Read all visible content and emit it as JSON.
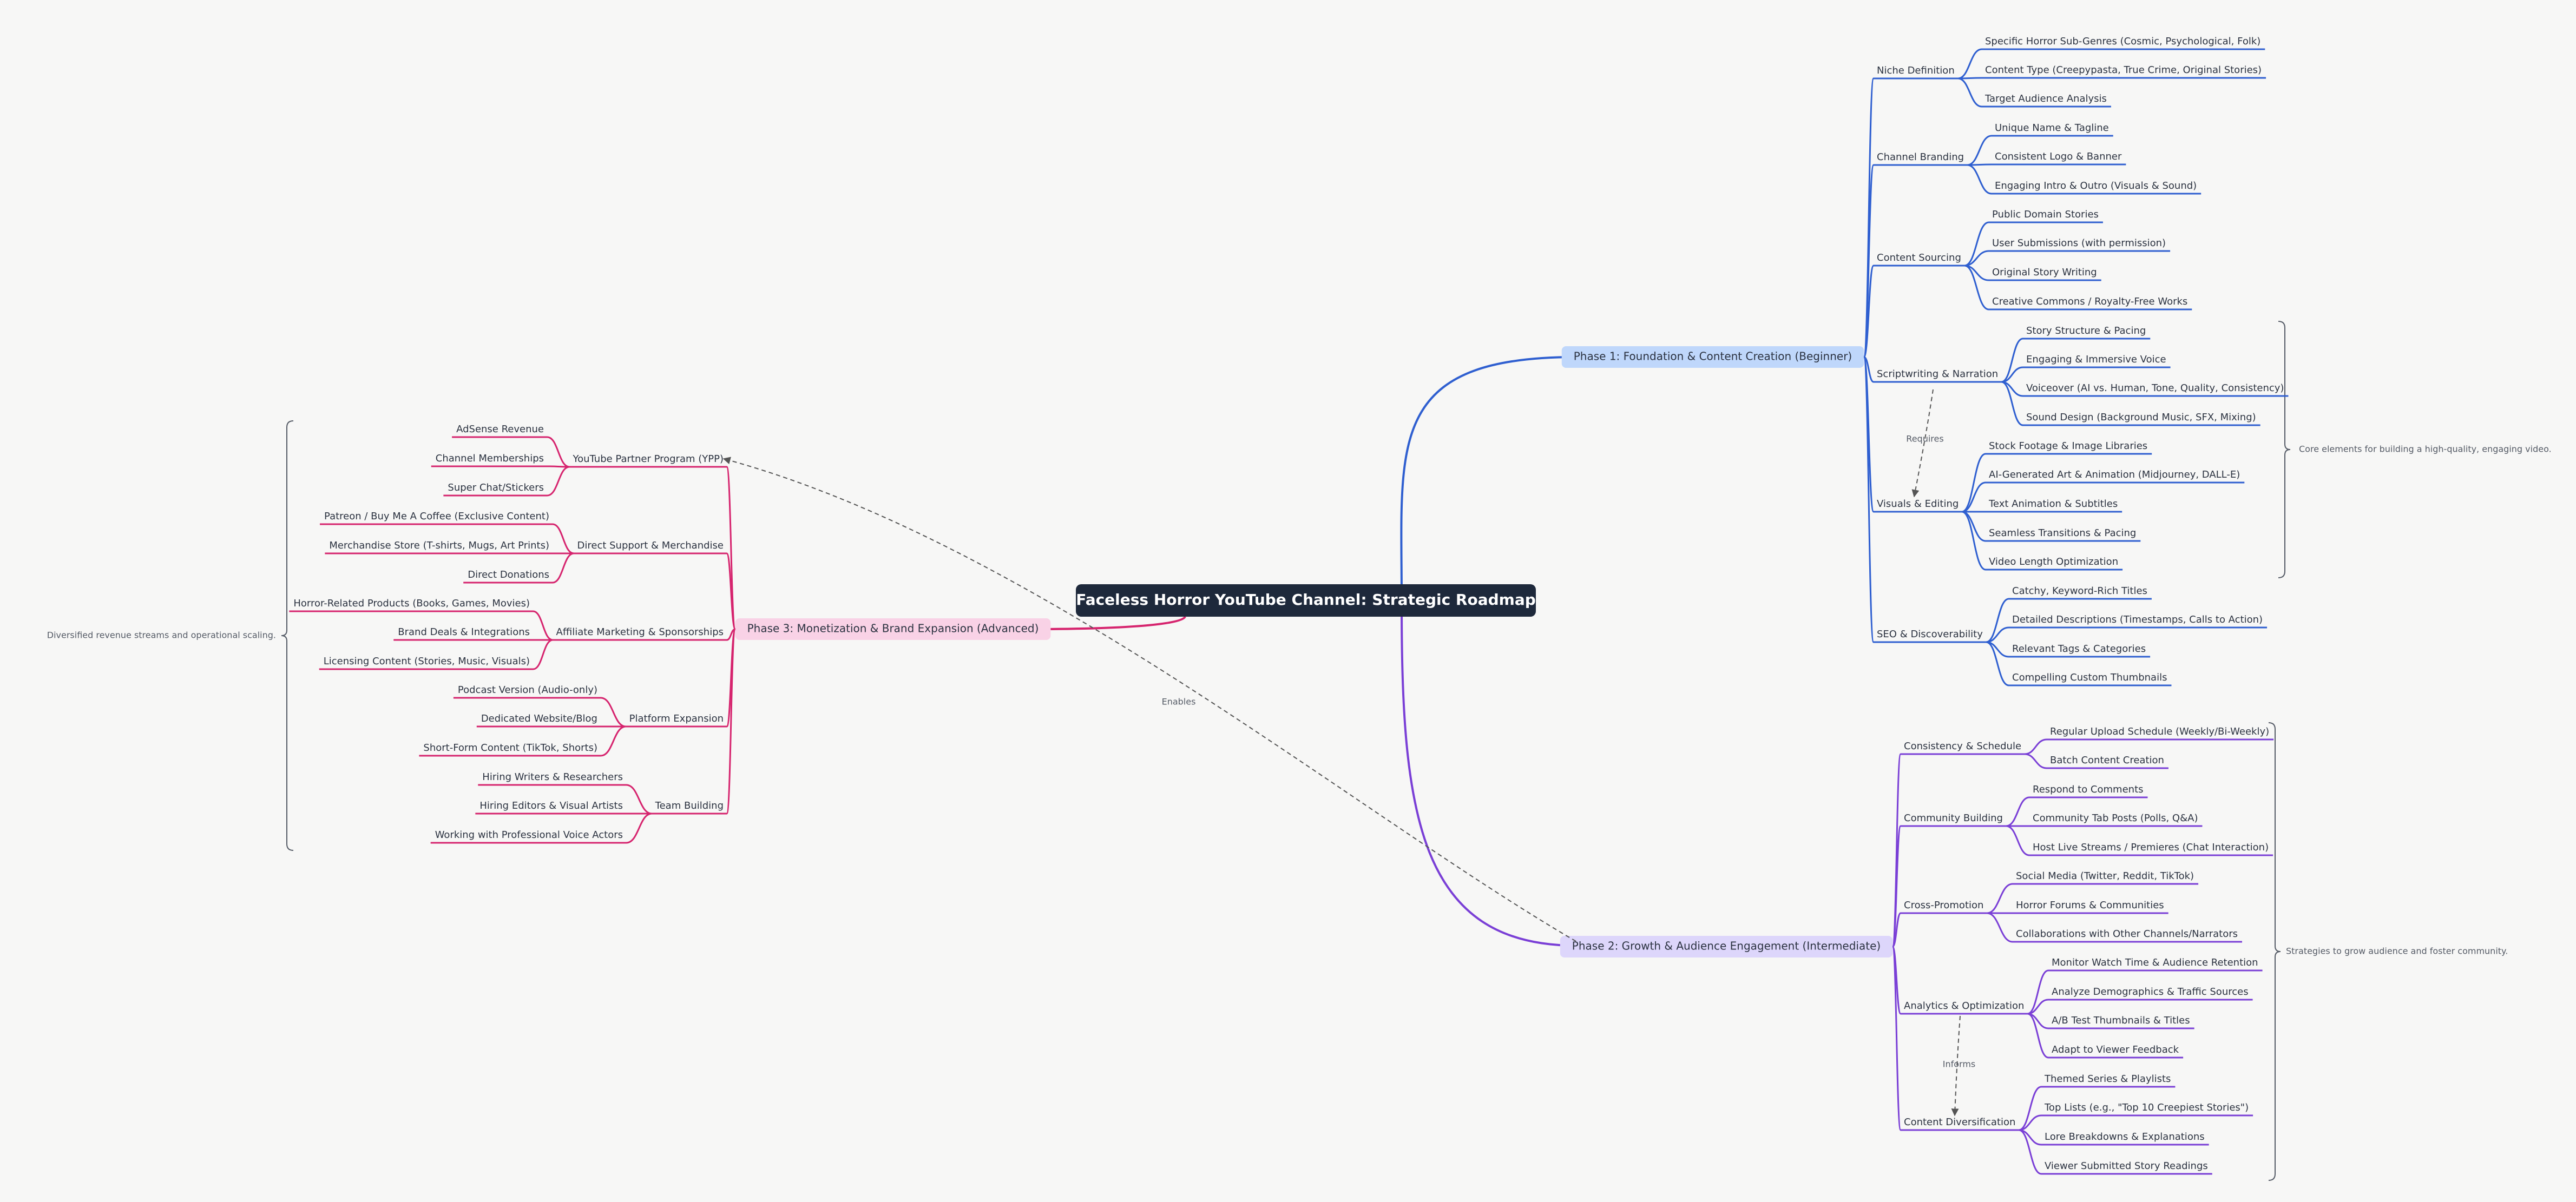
{
  "title": "Faceless Horror YouTube Channel: Strategic Roadmap",
  "colors": {
    "background": "#f7f7f6",
    "root_fill": "#1e293b",
    "phase1_line": "#2f5fd0",
    "phase1_fill": "#bfd7fb",
    "phase2_line": "#7a3fd6",
    "phase2_fill": "#ddd6fb",
    "phase3_line": "#d6246e",
    "phase3_fill": "#f9d2e6",
    "text": "#2b3240",
    "annotation": "#555b66"
  },
  "phase1": {
    "label": "Phase 1: Foundation & Content Creation (Beginner)",
    "summary": "Core elements for building a high-quality, engaging video.",
    "groups": [
      {
        "label": "Niche Definition",
        "items": [
          "Specific Horror Sub-Genres (Cosmic, Psychological, Folk)",
          "Content Type (Creepypasta, True Crime, Original Stories)",
          "Target Audience Analysis"
        ]
      },
      {
        "label": "Channel Branding",
        "items": [
          "Unique Name & Tagline",
          "Consistent Logo & Banner",
          "Engaging Intro & Outro (Visuals & Sound)"
        ]
      },
      {
        "label": "Content Sourcing",
        "items": [
          "Public Domain Stories",
          "User Submissions (with permission)",
          "Original Story Writing",
          "Creative Commons / Royalty-Free Works"
        ]
      },
      {
        "label": "Scriptwriting & Narration",
        "items": [
          "Story Structure & Pacing",
          "Engaging & Immersive Voice",
          "Voiceover (AI vs. Human, Tone, Quality, Consistency)",
          "Sound Design (Background Music, SFX, Mixing)"
        ]
      },
      {
        "label": "Visuals & Editing",
        "items": [
          "Stock Footage & Image Libraries",
          "AI-Generated Art & Animation (Midjourney, DALL-E)",
          "Text Animation & Subtitles",
          "Seamless Transitions & Pacing",
          "Video Length Optimization"
        ]
      },
      {
        "label": "SEO & Discoverability",
        "items": [
          "Catchy, Keyword-Rich Titles",
          "Detailed Descriptions (Timestamps, Calls to Action)",
          "Relevant Tags & Categories",
          "Compelling Custom Thumbnails"
        ]
      }
    ]
  },
  "phase2": {
    "label": "Phase 2: Growth & Audience Engagement (Intermediate)",
    "summary": "Strategies to grow audience and foster community.",
    "groups": [
      {
        "label": "Consistency & Schedule",
        "items": [
          "Regular Upload Schedule (Weekly/Bi-Weekly)",
          "Batch Content Creation"
        ]
      },
      {
        "label": "Community Building",
        "items": [
          "Respond to Comments",
          "Community Tab Posts (Polls, Q&A)",
          "Host Live Streams / Premieres (Chat Interaction)"
        ]
      },
      {
        "label": "Cross-Promotion",
        "items": [
          "Social Media (Twitter, Reddit, TikTok)",
          "Horror Forums & Communities",
          "Collaborations with Other Channels/Narrators"
        ]
      },
      {
        "label": "Analytics & Optimization",
        "items": [
          "Monitor Watch Time & Audience Retention",
          "Analyze Demographics & Traffic Sources",
          "A/B Test Thumbnails & Titles",
          "Adapt to Viewer Feedback"
        ]
      },
      {
        "label": "Content Diversification",
        "items": [
          "Themed Series & Playlists",
          "Top Lists (e.g., \"Top 10 Creepiest Stories\")",
          "Lore Breakdowns & Explanations",
          "Viewer Submitted Story Readings"
        ]
      }
    ]
  },
  "phase3": {
    "label": "Phase 3: Monetization & Brand Expansion (Advanced)",
    "summary": "Diversified revenue streams and operational scaling.",
    "groups": [
      {
        "label": "YouTube Partner Program (YPP)",
        "items": [
          "AdSense Revenue",
          "Channel Memberships",
          "Super Chat/Stickers"
        ]
      },
      {
        "label": "Direct Support & Merchandise",
        "items": [
          "Patreon / Buy Me A Coffee (Exclusive Content)",
          "Merchandise Store (T-shirts, Mugs, Art Prints)",
          "Direct Donations"
        ]
      },
      {
        "label": "Affiliate Marketing & Sponsorships",
        "items": [
          "Horror-Related Products (Books, Games, Movies)",
          "Brand Deals & Integrations",
          "Licensing Content (Stories, Music, Visuals)"
        ]
      },
      {
        "label": "Platform Expansion",
        "items": [
          "Podcast Version (Audio-only)",
          "Dedicated Website/Blog",
          "Short-Form Content (TikTok, Shorts)"
        ]
      },
      {
        "label": "Team Building",
        "items": [
          "Hiring Writers & Researchers",
          "Hiring Editors & Visual Artists",
          "Working with Professional Voice Actors"
        ]
      }
    ]
  },
  "links": {
    "requires": "Requires",
    "informs": "Informs",
    "enables": "Enables"
  }
}
